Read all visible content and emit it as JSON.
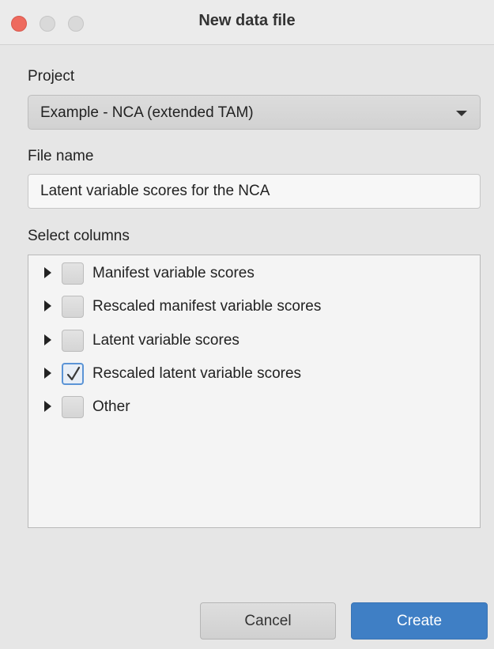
{
  "window": {
    "title": "New data file"
  },
  "project": {
    "label": "Project",
    "selected": "Example - NCA (extended TAM)"
  },
  "file_name": {
    "label": "File name",
    "value": "Latent variable scores for the NCA"
  },
  "columns": {
    "label": "Select columns",
    "items": [
      {
        "label": "Manifest variable scores",
        "checked": false
      },
      {
        "label": "Rescaled manifest variable scores",
        "checked": false
      },
      {
        "label": "Latent variable scores",
        "checked": false
      },
      {
        "label": "Rescaled latent variable scores",
        "checked": true
      },
      {
        "label": "Other",
        "checked": false
      }
    ]
  },
  "buttons": {
    "cancel": "Cancel",
    "create": "Create"
  },
  "colors": {
    "accent": "#3f7fc5",
    "close_light": "#ee6a5e",
    "window_bg": "#e6e6e6"
  },
  "icons": {
    "expander": "triangle-right-icon",
    "dropdown": "chevron-down-icon",
    "check": "checkmark-icon"
  }
}
